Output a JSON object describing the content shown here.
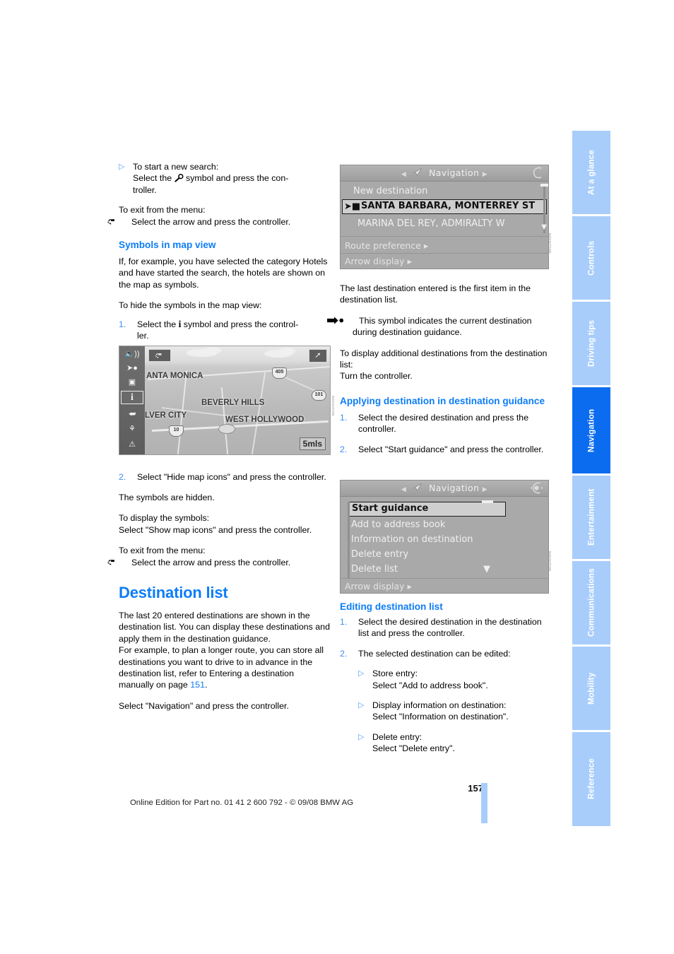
{
  "page": {
    "number": "157",
    "footer_text": "Online Edition for Part no. 01 41 2 600 792 - © 09/08 BMW AG"
  },
  "sidebar": {
    "tabs": [
      {
        "label": "At a glance",
        "active": false
      },
      {
        "label": "Controls",
        "active": false
      },
      {
        "label": "Driving tips",
        "active": false
      },
      {
        "label": "Navigation",
        "active": true
      },
      {
        "label": "Entertainment",
        "active": false
      },
      {
        "label": "Communications",
        "active": false
      },
      {
        "label": "Mobility",
        "active": false
      },
      {
        "label": "Reference",
        "active": false
      }
    ],
    "active_color": "#0b6cf0",
    "inactive_color": "#a8cdfb"
  },
  "left_column": {
    "bullet_new_search": {
      "line1": "To start a new search:",
      "line2_pre": "Select the",
      "line2_post": "symbol and press the con-",
      "line3": "troller."
    },
    "exit_menu_1": {
      "intro": "To exit from the menu:",
      "action": "Select the arrow and press the controller."
    },
    "symbols_heading": "Symbols in map view",
    "symbols_intro": "If, for example, you have selected the category Hotels and have started the search, the hotels are shown on the map as symbols.",
    "hide_intro": "To hide the symbols in the map view:",
    "step1": {
      "num": "1.",
      "pre": "Select the",
      "post": "symbol and press the control-",
      "cont": "ler."
    },
    "step2": {
      "num": "2.",
      "text": "Select \"Hide map icons\" and press the controller."
    },
    "symbols_hidden": "The symbols are hidden.",
    "display_symbols": {
      "line1": "To display the symbols:",
      "line2": "Select \"Show map icons\" and press the controller."
    },
    "exit_menu_2": {
      "intro": "To exit from the menu:",
      "action": "Select the arrow and press the controller."
    },
    "destination_list_heading": "Destination list",
    "destination_list_p1": "The last 20 entered destinations are shown in the destination list. You can display these destinations and apply them in the destination guidance.",
    "destination_list_p2_pre": "For example, to plan a longer route, you can store all destinations you want to drive to in advance in the destination list, refer to Entering a destination manually on page",
    "destination_list_p2_page": "151",
    "destination_list_p2_post": ".",
    "destination_list_p3": "Select \"Navigation\" and press the controller."
  },
  "right_column": {
    "p1": "The last destination entered is the first item in the destination list.",
    "p2": "This symbol indicates the current destination during destination guidance.",
    "p3": {
      "line1": "To display additional destinations from the destination list:",
      "line2": "Turn the controller."
    },
    "applying_heading": "Applying destination in destination guidance",
    "applying_step1": {
      "num": "1.",
      "text": "Select the desired destination and press the controller."
    },
    "applying_step2": {
      "num": "2.",
      "text": "Select \"Start guidance\" and press the controller."
    },
    "editing_heading": "Editing destination list",
    "editing_step1": {
      "num": "1.",
      "text": "Select the desired destination in the destination list and press the controller."
    },
    "editing_step2": {
      "num": "2.",
      "text": "The selected destination can be edited:"
    },
    "editing_sub": [
      {
        "line1": "Store entry:",
        "line2": "Select \"Add to address book\"."
      },
      {
        "line1": "Display information on destination:",
        "line2": "Select \"Information on destination\"."
      },
      {
        "line1": "Delete entry:",
        "line2": "Select \"Delete entry\"."
      }
    ]
  },
  "figures": {
    "map_screenshot": {
      "name": "map-view-screenshot",
      "icons": [
        "speaker-icon",
        "destination-arrow-icon",
        "split-screen-icon",
        "info-icon",
        "route-icon",
        "junction-icon",
        "warning-icon"
      ],
      "selected_icon": "info-icon",
      "labels": [
        "ANTA MONICA",
        "BEVERLY HILLS",
        "LVER CITY",
        "WEST HOLLYWOOD"
      ],
      "shields": [
        "405",
        "101",
        "10"
      ],
      "scale": "5mls"
    },
    "nav_menu_1": {
      "name": "navigation-menu-screenshot",
      "title": "Navigation",
      "rows": [
        {
          "label": "New destination",
          "selected": false,
          "marker": ""
        },
        {
          "label": "SANTA BARBARA, MONTERREY ST",
          "selected": true,
          "marker": "current-destination"
        },
        {
          "label": "MARINA DEL REY, ADMIRALTY W",
          "selected": false,
          "marker": ""
        }
      ],
      "sub_items": [
        "Route preference",
        "Arrow display"
      ]
    },
    "nav_menu_2": {
      "name": "destination-options-menu-screenshot",
      "title": "Navigation",
      "rows": [
        {
          "label": "Start guidance",
          "selected": true
        },
        {
          "label": "Add to address book",
          "selected": false
        },
        {
          "label": "Information on destination",
          "selected": false
        },
        {
          "label": "Delete entry",
          "selected": false
        },
        {
          "label": "Delete list",
          "selected": false
        }
      ],
      "sub_items": [
        "Arrow display"
      ]
    }
  }
}
